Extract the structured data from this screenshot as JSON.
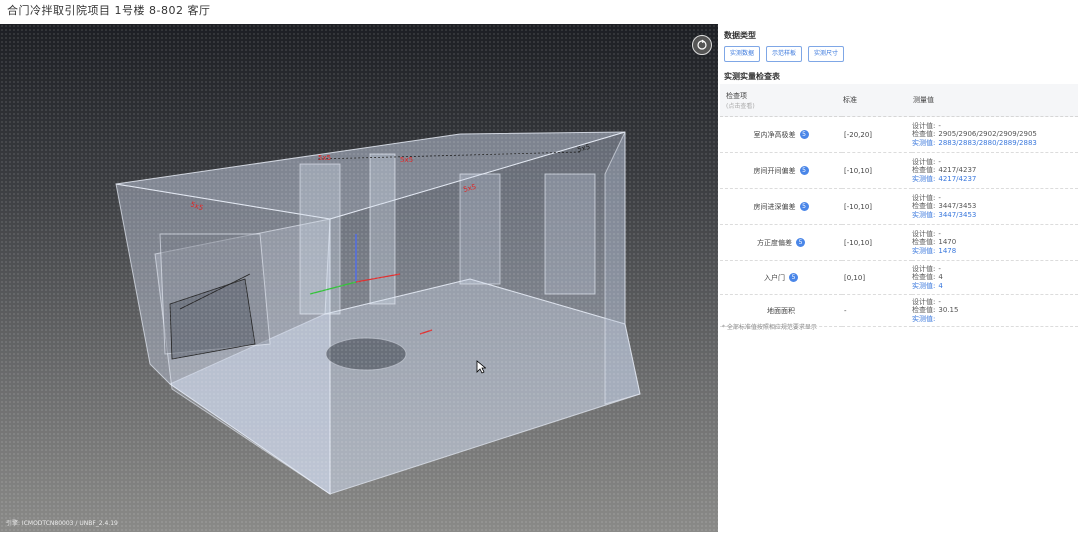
{
  "breadcrumb": "合门冷拌取引院项目 1号楼 8-802 客厅",
  "viewer": {
    "version_text": "引擎: ICMODTCN80003 / UNBF_2.4.19",
    "reset_icon": "refresh-circle-icon",
    "cursor_icon": "arrow-cursor-icon",
    "model_labels": [
      "5x5",
      "5x5",
      "5x5",
      "5x5",
      "5x5"
    ]
  },
  "panel": {
    "data_type_title": "数据类型",
    "buttons": [
      "实测数据",
      "示范样板",
      "实测尺寸"
    ],
    "table_title": "实测实量检查表",
    "headers": {
      "item": "检查项",
      "item_sub": "(点击查看)",
      "standard": "标准",
      "measured": "测量值"
    },
    "rows": [
      {
        "item": "室内净高极差",
        "badge": "5",
        "standard": "[-20,20]",
        "values": [
          {
            "label": "设计值:",
            "value": "-",
            "style": "normal"
          },
          {
            "label": "检查值:",
            "value": "2905/2906/2902/2909/2905",
            "style": "normal"
          },
          {
            "label": "实测值:",
            "value": "2883/2883/2880/2889/2883",
            "style": "blue"
          }
        ]
      },
      {
        "item": "房间开间偏差",
        "badge": "5",
        "standard": "[-10,10]",
        "values": [
          {
            "label": "设计值:",
            "value": "-",
            "style": "normal"
          },
          {
            "label": "检查值:",
            "value": "4217/4237",
            "style": "normal"
          },
          {
            "label": "实测值:",
            "value": "4217/4237",
            "style": "blue"
          }
        ]
      },
      {
        "item": "房间进深偏差",
        "badge": "5",
        "standard": "[-10,10]",
        "values": [
          {
            "label": "设计值:",
            "value": "-",
            "style": "normal"
          },
          {
            "label": "检查值:",
            "value": "3447/3453",
            "style": "normal"
          },
          {
            "label": "实测值:",
            "value": "3447/3453",
            "style": "blue"
          }
        ]
      },
      {
        "item": "方正度偏差",
        "badge": "5",
        "standard": "[-10,10]",
        "values": [
          {
            "label": "设计值:",
            "value": "-",
            "style": "normal"
          },
          {
            "label": "检查值:",
            "value": "1470",
            "style": "normal"
          },
          {
            "label": "实测值:",
            "value": "1478",
            "style": "blue"
          }
        ]
      },
      {
        "item": "入户门",
        "badge": "5",
        "standard": "[0,10]",
        "values": [
          {
            "label": "设计值:",
            "value": "-",
            "style": "normal"
          },
          {
            "label": "检查值:",
            "value": "4",
            "style": "normal"
          },
          {
            "label": "实测值:",
            "value": "4",
            "style": "blue"
          }
        ]
      },
      {
        "item": "地面面积",
        "badge": "",
        "standard": "-",
        "values": [
          {
            "label": "设计值:",
            "value": "-",
            "style": "normal"
          },
          {
            "label": "检查值:",
            "value": "30.15",
            "style": "normal"
          },
          {
            "label": "实测值:",
            "value": "",
            "style": "blue"
          }
        ]
      }
    ],
    "note": "* 全部标准值按照相应规范要求显示"
  },
  "colors": {
    "accent": "#3a78dd",
    "badge": "#4a86e8",
    "model_label": "#e02020"
  }
}
